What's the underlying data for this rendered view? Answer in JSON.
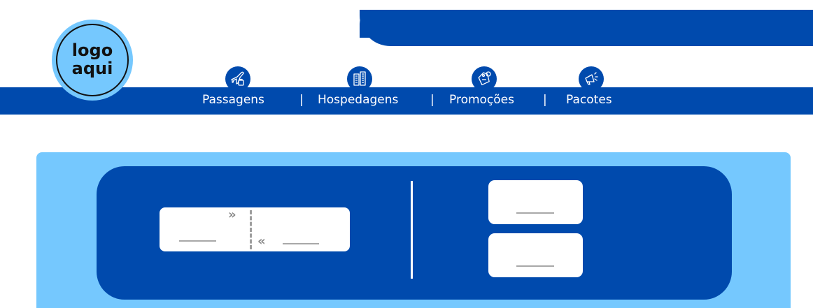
{
  "logo": {
    "line1": "logo",
    "line2": "aqui"
  },
  "nav": {
    "items": [
      {
        "label": "Passagens",
        "icon": "airplane-luggage-icon"
      },
      {
        "label": "Hospedagens",
        "icon": "buildings-icon"
      },
      {
        "label": "Promoções",
        "icon": "price-tag-icon"
      },
      {
        "label": "Pacotes",
        "icon": "megaphone-icon"
      }
    ],
    "separator": "|"
  },
  "search": {
    "arrow_forward": "»",
    "arrow_back": "«"
  },
  "colors": {
    "brand_dark": "#004aad",
    "brand_light": "#75c8fe",
    "white": "#ffffff",
    "placeholder_line": "#a8a8a8"
  }
}
